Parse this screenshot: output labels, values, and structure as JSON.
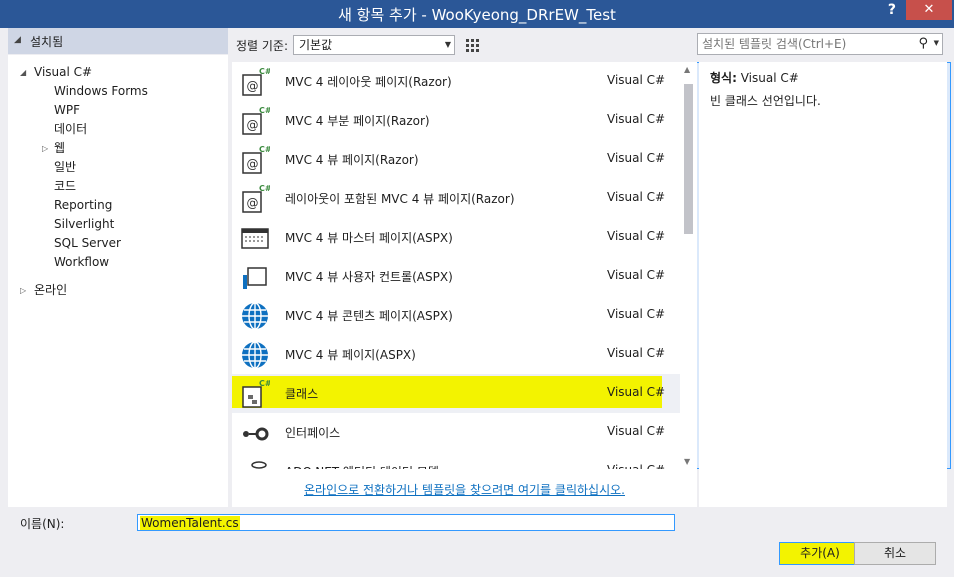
{
  "window": {
    "title": "새 항목 추가 - WooKyeong_DRrEW_Test",
    "help": "?",
    "close": "✕"
  },
  "left": {
    "header": "설치됨",
    "tree": [
      {
        "label": "Visual C#",
        "expander": "◢",
        "level": 0
      },
      {
        "label": "Windows Forms",
        "level": 1
      },
      {
        "label": "WPF",
        "level": 1
      },
      {
        "label": "데이터",
        "level": 1
      },
      {
        "label": "웹",
        "expander": "▷",
        "level": 1
      },
      {
        "label": "일반",
        "level": 1
      },
      {
        "label": "코드",
        "level": 1
      },
      {
        "label": "Reporting",
        "level": 1
      },
      {
        "label": "Silverlight",
        "level": 1
      },
      {
        "label": "SQL Server",
        "level": 1
      },
      {
        "label": "Workflow",
        "level": 1
      },
      {
        "label": "온라인",
        "expander": "▷",
        "level": 0
      }
    ]
  },
  "toolbar": {
    "sort_label": "정렬 기준:",
    "sort_value": "기본값",
    "search_placeholder": "설치된 템플릿 검색(Ctrl+E)"
  },
  "templates": [
    {
      "name": "MVC 4 레이아웃 페이지(Razor)",
      "type": "Visual C#",
      "icon": "razor-icon"
    },
    {
      "name": "MVC 4 부분 페이지(Razor)",
      "type": "Visual C#",
      "icon": "razor-icon"
    },
    {
      "name": "MVC 4 뷰 페이지(Razor)",
      "type": "Visual C#",
      "icon": "razor-icon"
    },
    {
      "name": "레이아웃이 포함된 MVC 4 뷰 페이지(Razor)",
      "type": "Visual C#",
      "icon": "razor-icon"
    },
    {
      "name": "MVC 4 뷰 마스터 페이지(ASPX)",
      "type": "Visual C#",
      "icon": "master-page-icon"
    },
    {
      "name": "MVC 4 뷰 사용자 컨트롤(ASPX)",
      "type": "Visual C#",
      "icon": "user-control-icon"
    },
    {
      "name": "MVC 4 뷰 콘텐츠 페이지(ASPX)",
      "type": "Visual C#",
      "icon": "globe-icon"
    },
    {
      "name": "MVC 4 뷰 페이지(ASPX)",
      "type": "Visual C#",
      "icon": "globe-icon"
    },
    {
      "name": "클래스",
      "type": "Visual C#",
      "icon": "class-icon",
      "selected": true
    },
    {
      "name": "인터페이스",
      "type": "Visual C#",
      "icon": "interface-icon"
    },
    {
      "name": "ADO.NET 엔터티 데이터 모델",
      "type": "Visual C#",
      "icon": "data-model-icon"
    }
  ],
  "online_link": "온라인으로 전환하거나 템플릿을 찾으려면 여기를 클릭하십시오.",
  "detail": {
    "kind_label": "형식:",
    "kind_value": "Visual C#",
    "description": "빈 클래스 선언입니다."
  },
  "bottom": {
    "name_label": "이름(N):",
    "name_value": "WomenTalent.cs",
    "add_button": "추가(A)",
    "cancel_button": "취소"
  },
  "colors": {
    "title_bar": "#2b5797",
    "close_button": "#c7504b",
    "highlight": "#f3f300",
    "link": "#0e70c0",
    "icon_green": "#3b8a3e",
    "icon_blue": "#0e70c0"
  }
}
